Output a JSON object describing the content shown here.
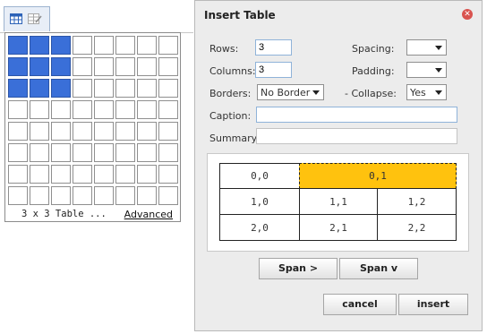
{
  "picker": {
    "rows": 8,
    "cols": 8,
    "selected_rows": 3,
    "selected_cols": 3,
    "status": "3 x 3 Table ...",
    "advanced_label": "Advanced"
  },
  "toolbar": {
    "table_icon": "table-icon",
    "table_props_icon": "table-properties-icon"
  },
  "dialog": {
    "title": "Insert Table",
    "rows_label": "Rows:",
    "rows_value": "3",
    "columns_label": "Columns:",
    "columns_value": "3",
    "borders_label": "Borders:",
    "borders_value": "No Border",
    "spacing_label": "Spacing:",
    "spacing_value": "",
    "padding_label": "Padding:",
    "padding_value": "",
    "collapse_label": "- Collapse:",
    "collapse_value": "Yes",
    "caption_label": "Caption:",
    "caption_value": "",
    "summary_label": "Summary:",
    "summary_value": "",
    "span_right_label": "Span >",
    "span_down_label": "Span v",
    "cancel_label": "cancel",
    "insert_label": "insert"
  },
  "preview": {
    "rows": [
      [
        "0,0",
        "0,1"
      ],
      [
        "1,0",
        "1,1",
        "1,2"
      ],
      [
        "2,0",
        "2,1",
        "2,2"
      ]
    ],
    "highlight_color": "#ffc20e"
  }
}
